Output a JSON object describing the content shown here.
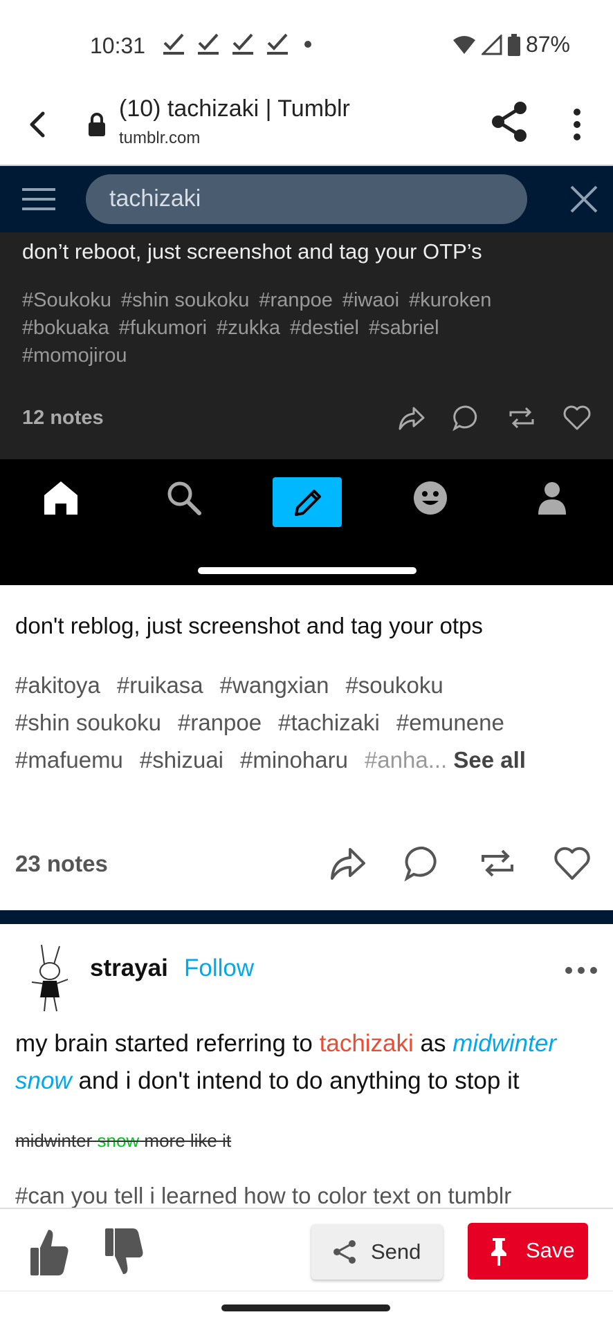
{
  "status_bar": {
    "time": "10:31",
    "battery": "87%"
  },
  "browser": {
    "title": "(10) tachizaki | Tumblr",
    "url": "tumblr.com"
  },
  "tumblr_search": {
    "query": "tachizaki"
  },
  "dark_post": {
    "text": "don’t reboot, just screenshot and tag your OTP’s",
    "tags": [
      "#Soukoku",
      "#shin soukoku",
      "#ranpoe",
      "#iwaoi",
      "#kuroken",
      "#bokuaka",
      "#fukumori",
      "#zukka",
      "#destiel",
      "#sabriel",
      "#momojirou"
    ],
    "notes": "12 notes"
  },
  "post1": {
    "text": "don't reblog, just screenshot and tag your otps",
    "tags": [
      "#akitoya",
      "#ruikasa",
      "#wangxian",
      "#soukoku",
      "#shin soukoku",
      "#ranpoe",
      "#tachizaki",
      "#emunene",
      "#mafuemu",
      "#shizuai",
      "#minoharu"
    ],
    "truncated_tag": "#anha",
    "ellipsis": "...",
    "see_all": "See all",
    "notes": "23 notes"
  },
  "post2": {
    "username": "strayai",
    "follow_label": "Follow",
    "body_part1": "my brain started referring to ",
    "body_red": "tachizaki",
    "body_part2": " as ",
    "body_blue": "midwinter snow",
    "body_part3": " and i don't intend to do anything to stop it",
    "strike_part1": "midwinter ",
    "strike_green": "snow",
    "strike_part2": " more like it",
    "tagline": "#can you tell i learned how to color text on tumblr"
  },
  "bottom_bar": {
    "send_label": "Send",
    "save_label": "Save"
  },
  "colors": {
    "tumblr_navy": "#001935",
    "tumblr_blue": "#00b8ff",
    "pinterest_red": "#e60023",
    "red_text": "#ee4c32",
    "blue_text": "#00a8f0",
    "green_text": "#00c41f"
  }
}
